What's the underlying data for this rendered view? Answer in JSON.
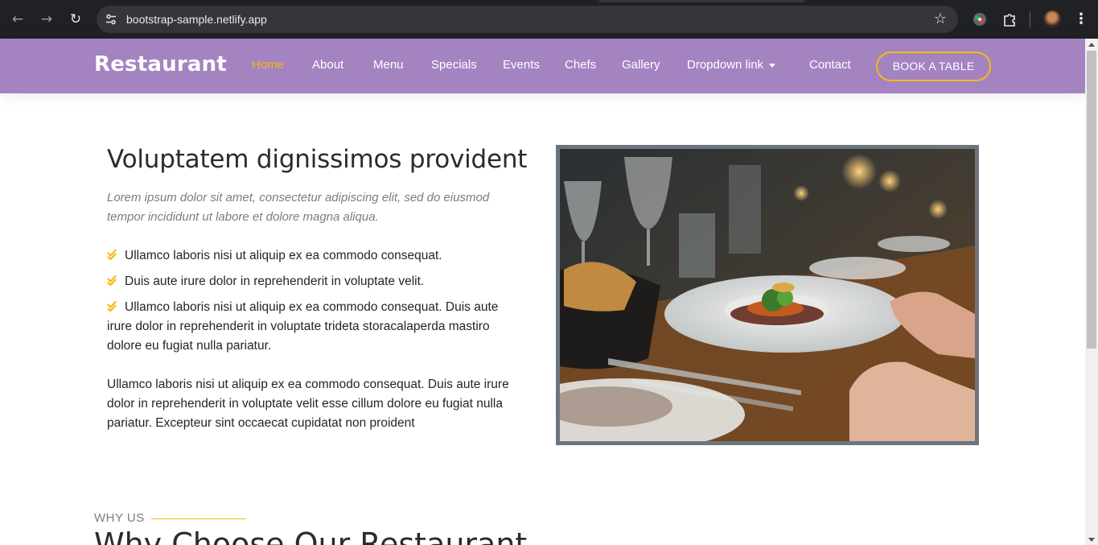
{
  "browser": {
    "url": "bootstrap-sample.netlify.app",
    "icons": {
      "back": "arrow-left",
      "forward": "arrow-right",
      "reload": "reload",
      "site_info": "tune",
      "bookmark": "star",
      "extension1": "color-circle",
      "extensions": "puzzle",
      "menu": "vertical-dots"
    }
  },
  "header": {
    "logo": "Restaurant",
    "nav": {
      "home": "Home",
      "about": "About",
      "menu": "Menu",
      "specials": "Specials",
      "events": "Events",
      "chefs": "Chefs",
      "gallery": "Gallery",
      "dropdown": "Dropdown link",
      "contact": "Contact"
    },
    "book_button": "BOOK A TABLE",
    "colors": {
      "background": "#a483c1",
      "accent": "#f5b914"
    }
  },
  "about": {
    "title": "Voluptatem dignissimos provident",
    "lede": "Lorem ipsum dolor sit amet, consectetur adipiscing elit, sed do eiusmod tempor incididunt ut labore et dolore magna aliqua.",
    "bullets": [
      "Ullamco laboris nisi ut aliquip ex ea commodo consequat.",
      "Duis aute irure dolor in reprehenderit in voluptate velit.",
      "Ullamco laboris nisi ut aliquip ex ea commodo consequat. Duis aute irure dolor in reprehenderit in voluptate trideta storacalaperda mastiro dolore eu fugiat nulla pariatur."
    ],
    "paragraph": "Ullamco laboris nisi ut aliquip ex ea commodo consequat. Duis aute irure dolor in reprehenderit in voluptate velit esse cillum dolore eu fugiat nulla pariatur. Excepteur sint occaecat cupidatat non proident",
    "image": "restaurant-table-photo"
  },
  "why": {
    "label": "WHY US",
    "title": "Why Choose Our Restaurant"
  }
}
